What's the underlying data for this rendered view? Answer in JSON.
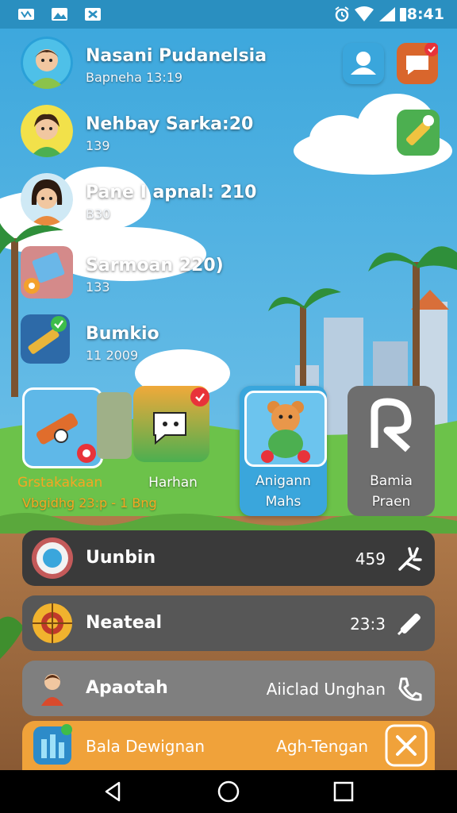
{
  "status_bar": {
    "time": "8:41"
  },
  "contacts": [
    {
      "name": "Nasani Pudanelsia",
      "sub": "Bapneha 13:19"
    },
    {
      "name": "Nehbay Sarka:20",
      "sub": "139"
    },
    {
      "name": "Pane I apnal: 210",
      "sub": "B30"
    },
    {
      "name": "Sarmoan 220)",
      "sub": "133"
    },
    {
      "name": "Bumkio",
      "sub": "11 2009"
    }
  ],
  "tiles": [
    {
      "line1": "Grstakakaan",
      "line2": "Vbgidhg 23:p - 1 Bng"
    },
    {
      "line1": "Harhan",
      "line2": ""
    },
    {
      "line1": "Anigann",
      "line2": "Mahs"
    },
    {
      "line1": "Bamia",
      "line2": "Praen"
    }
  ],
  "bars": [
    {
      "label": "Uunbin",
      "value": "459"
    },
    {
      "label": "Neateal",
      "value": "23:3"
    },
    {
      "label": "Apaotah",
      "value": "Aiiclad Unghan"
    },
    {
      "label": "Bala Dewignan",
      "value": "Agh-Tengan"
    }
  ]
}
